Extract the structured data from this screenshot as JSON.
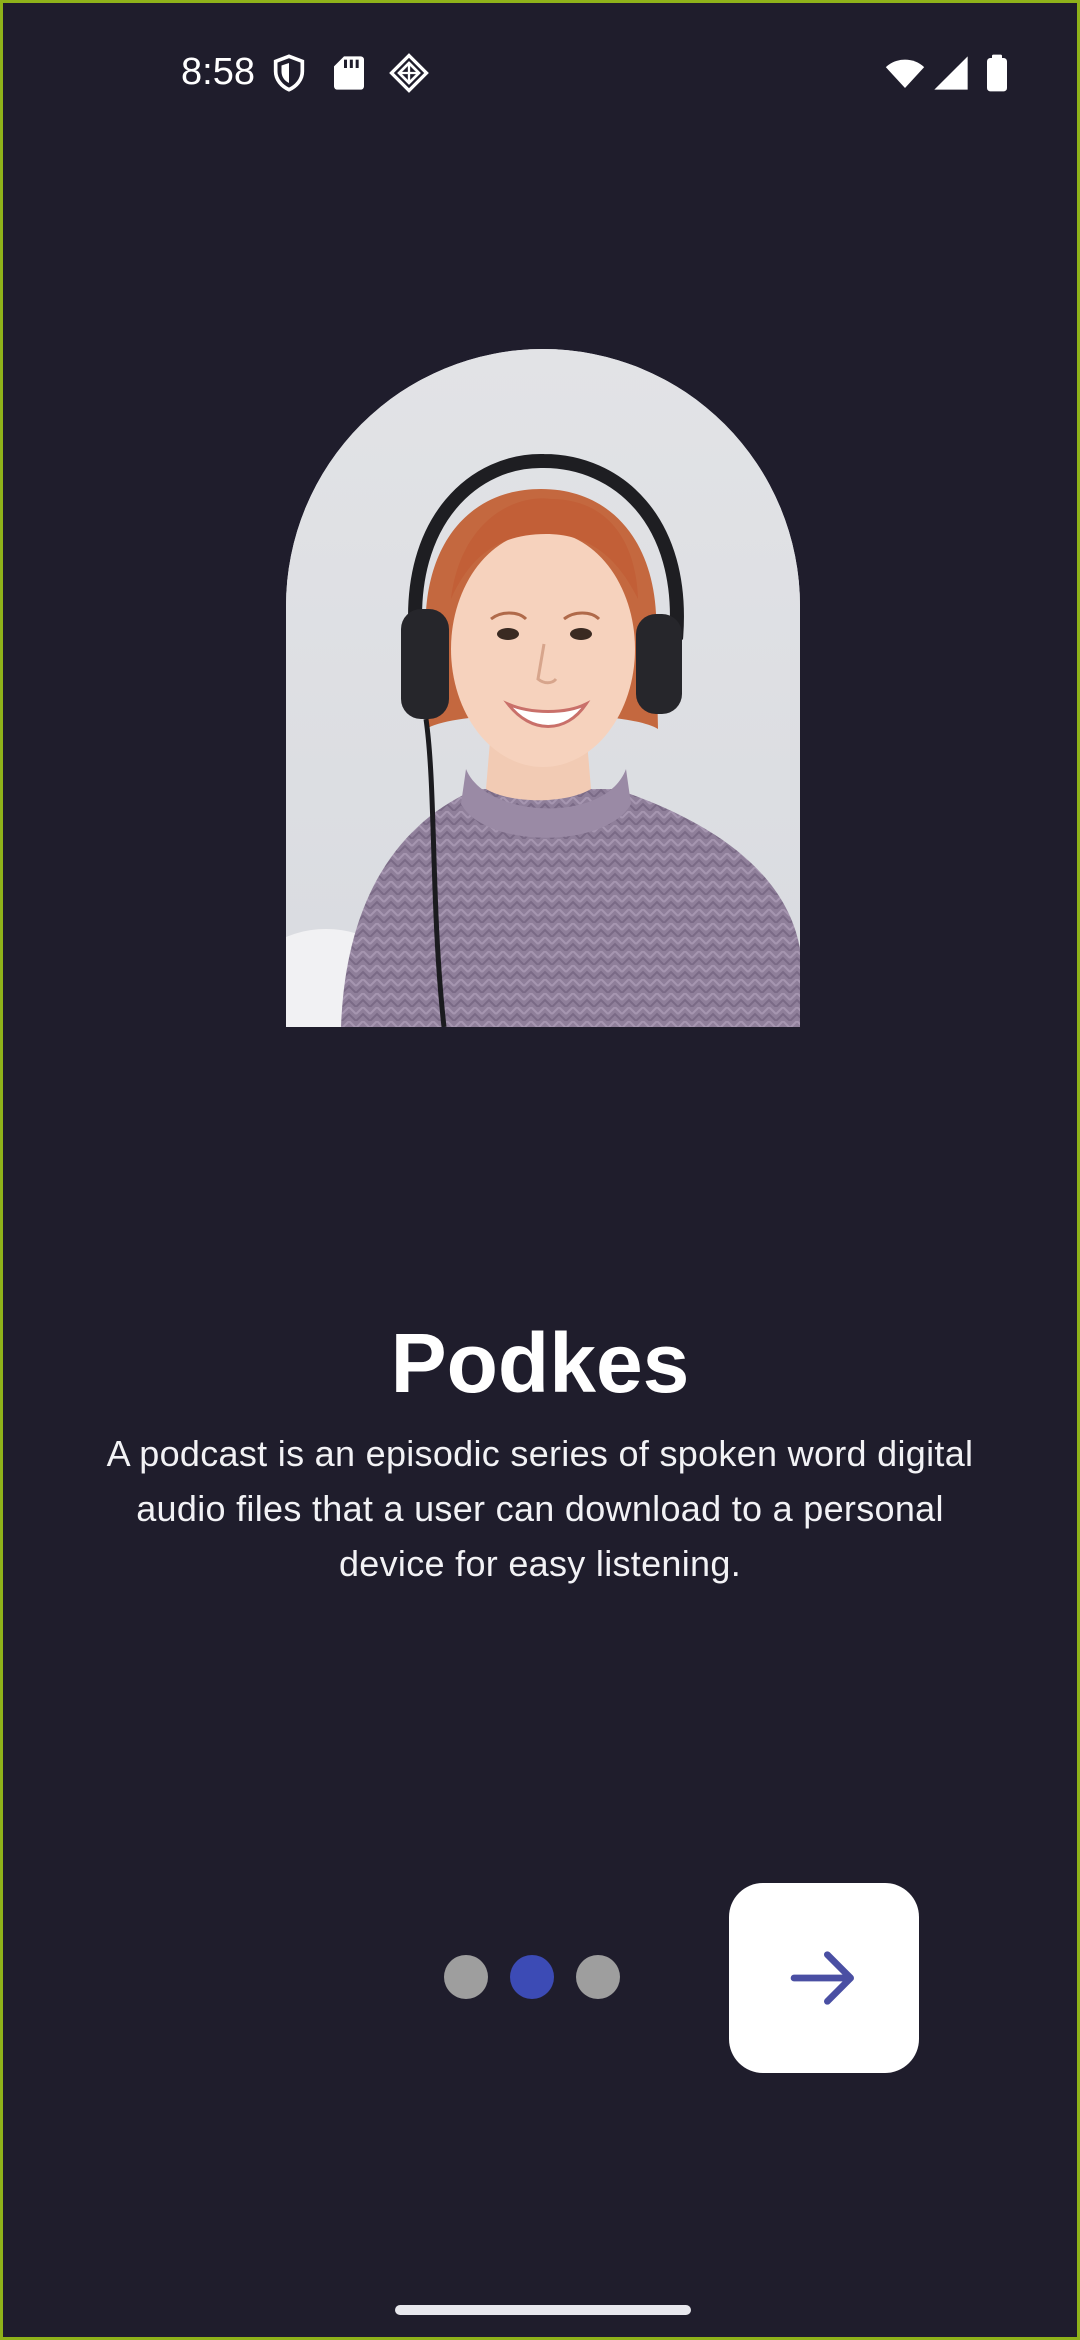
{
  "status_bar": {
    "time": "8:58",
    "left_icons": [
      "shield-icon",
      "sd-card-icon",
      "vpn-key-icon"
    ],
    "right_icons": [
      "wifi-icon",
      "signal-icon",
      "battery-icon"
    ]
  },
  "onboarding": {
    "image": "woman-with-headphones-photo",
    "title": "Podkes",
    "description": "A podcast is an episodic series of spoken word digital audio files that a user can download to a personal device for easy listening.",
    "pager": {
      "total_pages": 3,
      "current_page": 2
    },
    "next_button_icon": "arrow-right-icon"
  },
  "colors": {
    "background": "#1f1d2c",
    "dot_inactive": "#9e9e9e",
    "dot_active": "#3c4bb5",
    "arrow": "#4a4fa3",
    "button_bg": "#ffffff"
  }
}
